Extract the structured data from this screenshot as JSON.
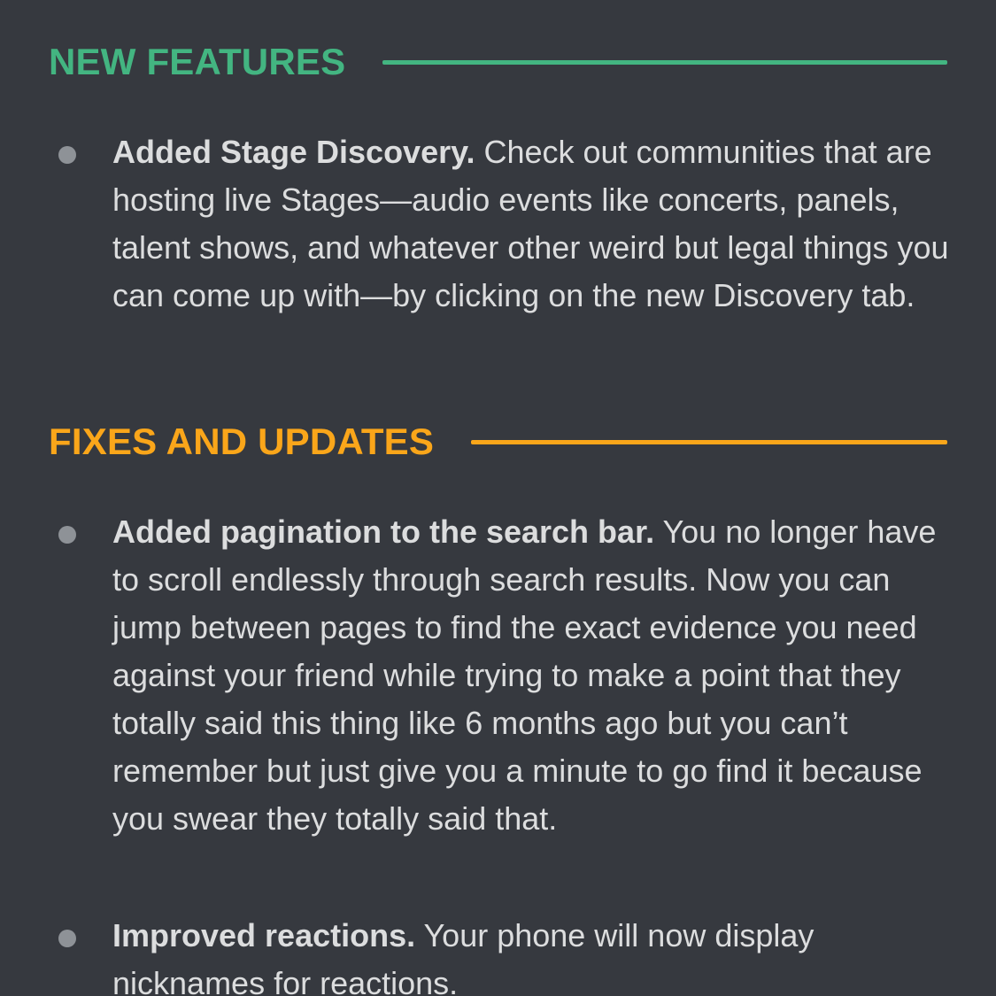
{
  "sections": {
    "new_features": {
      "title": "NEW FEATURES",
      "color": "#43b581",
      "items": [
        {
          "bold": "Added Stage Discovery.",
          "text": " Check out communities that are hosting live Stages—audio events like concerts, panels, talent shows, and whatever other weird but legal things you can come up with—by clicking on the new Discovery tab."
        }
      ]
    },
    "fixes_and_updates": {
      "title": "FIXES AND UPDATES",
      "color": "#faa61a",
      "items": [
        {
          "bold": "Added pagination to the search bar.",
          "text": " You no longer have to scroll endlessly through search results. Now you can jump between pages to find the exact evidence you need against your friend while trying to make a point that they totally said this thing like 6 months ago but you can’t remember but just give you a minute to go find it because you swear they totally said that."
        },
        {
          "bold": "Improved reactions.",
          "text": " Your phone will now display nicknames for reactions."
        }
      ]
    }
  }
}
